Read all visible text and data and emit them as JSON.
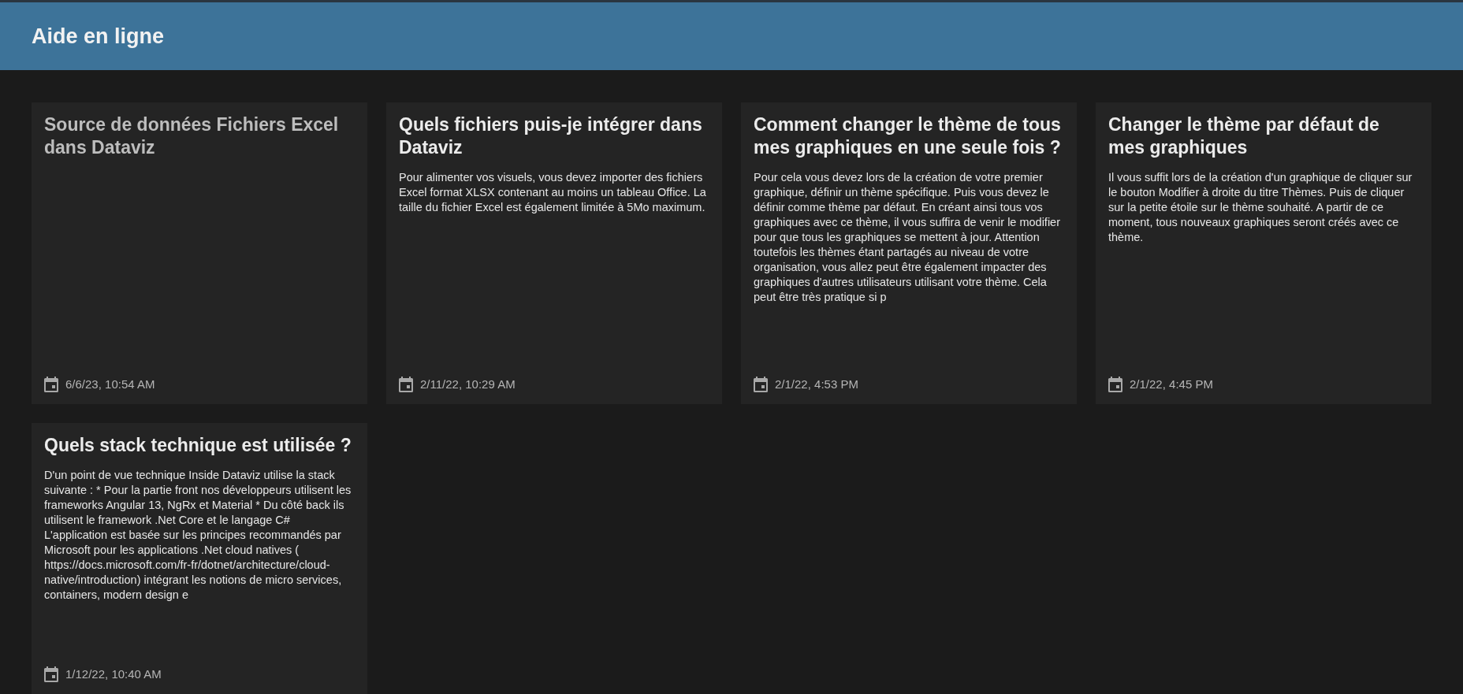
{
  "header": {
    "title": "Aide en ligne"
  },
  "articles": [
    {
      "title": "Source de données Fichiers Excel dans Dataviz",
      "dimmed": true,
      "date": "6/6/23, 10:54 AM"
    },
    {
      "title": "Quels fichiers puis-je intégrer dans Dataviz",
      "dimmed": false,
      "body": "Pour alimenter vos visuels, vous devez importer des fichiers Excel format XLSX contenant au moins un tableau Office. La taille du fichier Excel est également limitée à 5Mo maximum.",
      "date": "2/11/22, 10:29 AM"
    },
    {
      "title": "Comment changer le thème de tous mes graphiques en une seule fois ?",
      "dimmed": false,
      "body": "Pour cela vous devez lors de la création de votre premier graphique, définir un thème spécifique. Puis vous devez le définir comme thème par défaut. En créant ainsi tous vos graphiques avec ce thème, il vous suffira de venir le modifier pour que tous les graphiques se mettent à jour. Attention toutefois les thèmes étant partagés au niveau de votre organisation, vous allez peut être également impacter des graphiques d'autres utilisateurs utilisant votre thème. Cela peut être très pratique si p",
      "date": "2/1/22, 4:53 PM"
    },
    {
      "title": "Changer le thème par défaut de mes graphiques",
      "dimmed": false,
      "body": "Il vous suffit lors de la création d'un graphique de cliquer sur le bouton Modifier à droite du titre Thèmes. Puis de cliquer sur la petite étoile sur le thème souhaité. A partir de ce moment, tous nouveaux graphiques seront créés avec ce thème.",
      "date": "2/1/22, 4:45 PM"
    },
    {
      "title": "Quels stack technique est utilisée ?",
      "dimmed": false,
      "body": "D'un point de vue technique Inside Dataviz utilise la stack suivante : * Pour la partie front nos développeurs utilisent les frameworks Angular 13, NgRx et Material * Du côté back ils utilisent le framework .Net Core et le langage C# L'application est basée sur les principes recommandés par Microsoft pour les applications .Net cloud natives ( https://docs.microsoft.com/fr-fr/dotnet/architecture/cloud-native/introduction) intégrant les notions de micro services, containers, modern design e",
      "date": "1/12/22, 10:40 AM"
    }
  ]
}
